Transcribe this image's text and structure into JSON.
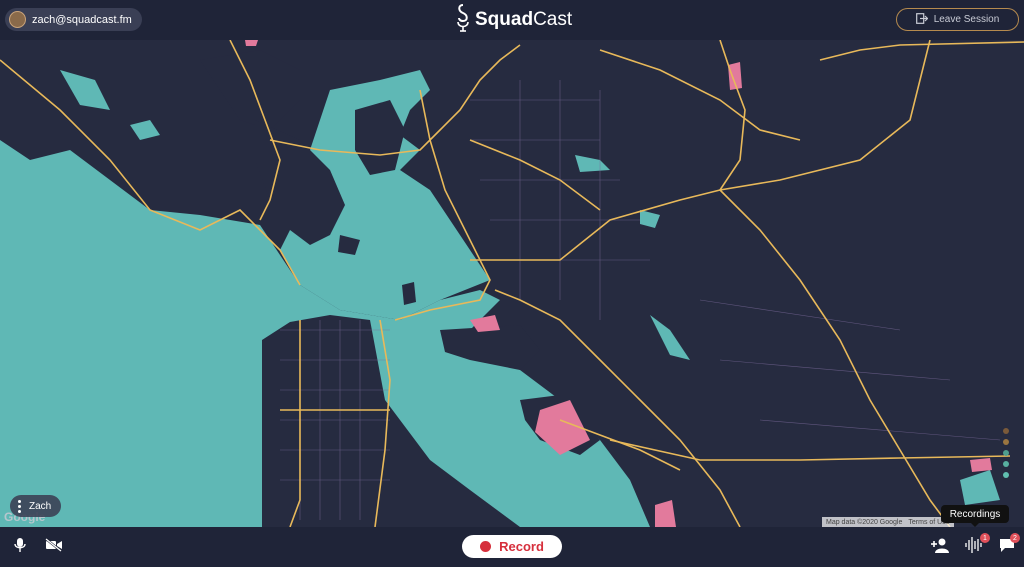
{
  "header": {
    "user_email": "zach@squadcast.fm",
    "logo_bold": "Squad",
    "logo_regular": "Cast",
    "leave_label": "Leave Session"
  },
  "map": {
    "google_label": "Google",
    "attribution_data": "Map data ©2020 Google",
    "attribution_terms": "Terms of Use"
  },
  "participant": {
    "name": "Zach"
  },
  "bottom": {
    "record_label": "Record",
    "recordings_tooltip": "Recordings",
    "recordings_badge": "1",
    "chat_badge": "2"
  },
  "icons": [
    "microphone-icon",
    "video-off-icon",
    "add-person-icon",
    "waveform-icon",
    "chat-icon",
    "leave-icon",
    "podcast-mic-logo-icon"
  ],
  "colors": {
    "bar_bg": "#1f2438",
    "land": "#262b40",
    "water": "#5fb8b5",
    "roads": "#e8b95a",
    "accent": "#e27a9c",
    "record": "#d62f3c",
    "leave_border": "#b58a4e",
    "slider_dots": [
      "#7a5a3a",
      "#9a7540",
      "#4f9e8e",
      "#58b0a0",
      "#60bfb0"
    ]
  }
}
